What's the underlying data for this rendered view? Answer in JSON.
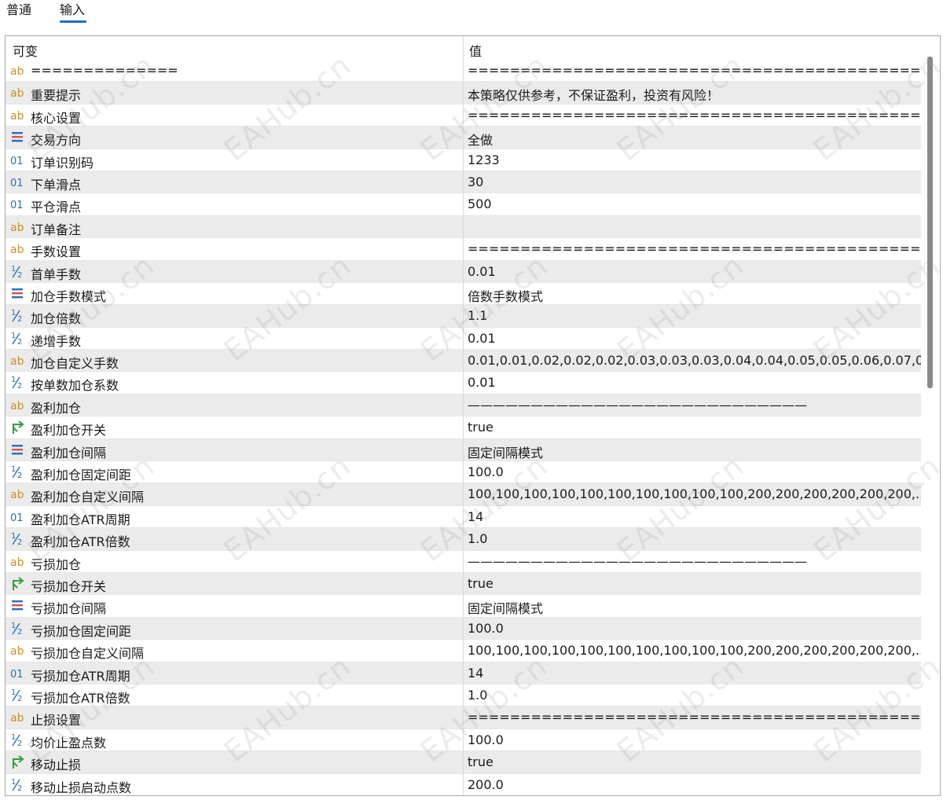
{
  "tabs": [
    {
      "label": "普通",
      "active": false
    },
    {
      "label": "输入",
      "active": true
    }
  ],
  "table": {
    "columns": [
      "可变",
      "值"
    ],
    "rows": [
      {
        "icon": "ab-string-icon",
        "name": "==============",
        "value": "==================================================="
      },
      {
        "icon": "ab-string-icon",
        "name": "重要提示",
        "value": "本策略仅供参考，不保证盈利，投资有风险！"
      },
      {
        "icon": "ab-string-icon",
        "name": "核心设置",
        "value": "========================================================="
      },
      {
        "icon": "enum-list-icon",
        "name": "交易方向",
        "value": "全做"
      },
      {
        "icon": "integer-01-icon",
        "name": "订单识别码",
        "value": "1233"
      },
      {
        "icon": "integer-01-icon",
        "name": "下单滑点",
        "value": "30"
      },
      {
        "icon": "integer-01-icon",
        "name": "平仓滑点",
        "value": "500"
      },
      {
        "icon": "ab-string-icon",
        "name": "订单备注",
        "value": ""
      },
      {
        "icon": "ab-string-icon",
        "name": "手数设置",
        "value": "========================================================="
      },
      {
        "icon": "double-half-icon",
        "name": "首单手数",
        "value": "0.01"
      },
      {
        "icon": "enum-list-icon",
        "name": "加仓手数模式",
        "value": "倍数手数模式"
      },
      {
        "icon": "double-half-icon",
        "name": "加仓倍数",
        "value": "1.1"
      },
      {
        "icon": "double-half-icon",
        "name": "递增手数",
        "value": "0.01"
      },
      {
        "icon": "ab-string-icon",
        "name": "加仓自定义手数",
        "value": "0.01,0.01,0.02,0.02,0.02,0.03,0.03,0.03,0.04,0.04,0.05,0.05,0.06,0.07,0...."
      },
      {
        "icon": "double-half-icon",
        "name": "按单数加仓系数",
        "value": "0.01"
      },
      {
        "icon": "ab-string-icon",
        "name": "盈利加仓",
        "value": "———————————————————————————"
      },
      {
        "icon": "bool-arrow-icon",
        "name": "盈利加仓开关",
        "value": "true"
      },
      {
        "icon": "enum-list-icon",
        "name": "盈利加仓间隔",
        "value": "固定间隔模式"
      },
      {
        "icon": "double-half-icon",
        "name": "盈利加仓固定间距",
        "value": "100.0"
      },
      {
        "icon": "ab-string-icon",
        "name": "盈利加仓自定义间隔",
        "value": "100,100,100,100,100,100,100,100,100,100,200,200,200,200,200,200,..."
      },
      {
        "icon": "integer-01-icon",
        "name": "盈利加仓ATR周期",
        "value": "14"
      },
      {
        "icon": "double-half-icon",
        "name": "盈利加仓ATR倍数",
        "value": "1.0"
      },
      {
        "icon": "ab-string-icon",
        "name": "亏损加仓",
        "value": "———————————————————————————"
      },
      {
        "icon": "bool-arrow-icon",
        "name": "亏损加仓开关",
        "value": "true"
      },
      {
        "icon": "enum-list-icon",
        "name": "亏损加仓间隔",
        "value": "固定间隔模式"
      },
      {
        "icon": "double-half-icon",
        "name": "亏损加仓固定间距",
        "value": "100.0"
      },
      {
        "icon": "ab-string-icon",
        "name": "亏损加仓自定义间隔",
        "value": "100,100,100,100,100,100,100,100,100,100,200,200,200,200,200,200,..."
      },
      {
        "icon": "integer-01-icon",
        "name": "亏损加仓ATR周期",
        "value": "14"
      },
      {
        "icon": "double-half-icon",
        "name": "亏损加仓ATR倍数",
        "value": "1.0"
      },
      {
        "icon": "ab-string-icon",
        "name": "止损设置",
        "value": "========================================================="
      },
      {
        "icon": "double-half-icon",
        "name": "均价止盈点数",
        "value": "100.0"
      },
      {
        "icon": "bool-arrow-icon",
        "name": "移动止损",
        "value": "true"
      },
      {
        "icon": "double-half-icon",
        "name": "移动止损启动点数",
        "value": "200.0"
      }
    ]
  },
  "watermark": "EAHub.cn",
  "colors": {
    "accent": "#1e6fc8",
    "ab_icon": "#c9902a",
    "int_icon": "#2a6fb8",
    "double_icon": "#2a6fb8",
    "bool_icon": "#2e9e3a",
    "enum_icon_red": "#d9534f",
    "enum_icon_blue": "#2a6fb8",
    "row_alt": "#ebebeb"
  }
}
